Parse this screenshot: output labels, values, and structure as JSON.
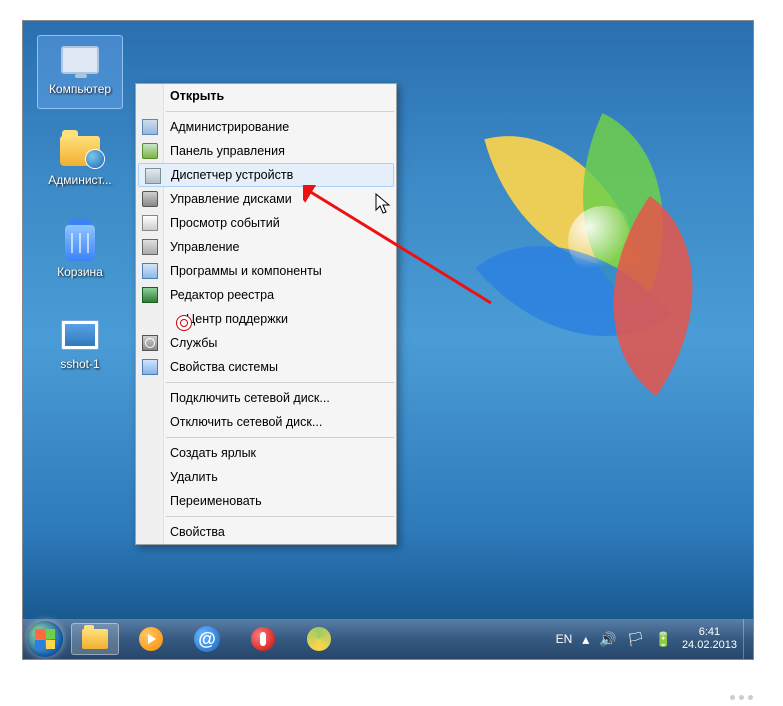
{
  "desktop_icons": [
    {
      "name": "computer-icon",
      "label": "Компьютер",
      "kind": "monitor",
      "selected": true
    },
    {
      "name": "admin-icon",
      "label": "Админист...",
      "kind": "folder-user",
      "selected": false
    },
    {
      "name": "recycle-bin-icon",
      "label": "Корзина",
      "kind": "bin",
      "selected": false
    },
    {
      "name": "sshot-icon",
      "label": "sshot-1",
      "kind": "thumb",
      "selected": false
    }
  ],
  "context_menu": {
    "header": "Открыть",
    "groups": [
      [
        {
          "icon": "ci-admin",
          "label": "Администрирование",
          "hl": false
        },
        {
          "icon": "ci-cp",
          "label": "Панель управления",
          "hl": false
        },
        {
          "icon": "ci-dev",
          "label": "Диспетчер устройств",
          "hl": true
        },
        {
          "icon": "ci-disk",
          "label": "Управление дисками",
          "hl": false
        },
        {
          "icon": "ci-event",
          "label": "Просмотр событий",
          "hl": false
        },
        {
          "icon": "ci-mgmt",
          "label": "Управление",
          "hl": false
        },
        {
          "icon": "ci-prog",
          "label": "Программы и компоненты",
          "hl": false
        },
        {
          "icon": "ci-reg",
          "label": "Редактор реестра",
          "hl": false
        },
        {
          "icon": "ci-sup",
          "label": "Центр поддержки",
          "hl": false
        },
        {
          "icon": "ci-svc",
          "label": "Службы",
          "hl": false
        },
        {
          "icon": "ci-sys",
          "label": "Свойства системы",
          "hl": false
        }
      ],
      [
        {
          "icon": "",
          "label": "Подключить сетевой диск...",
          "hl": false
        },
        {
          "icon": "",
          "label": "Отключить сетевой диск...",
          "hl": false
        }
      ],
      [
        {
          "icon": "",
          "label": "Создать ярлык",
          "hl": false
        },
        {
          "icon": "",
          "label": "Удалить",
          "hl": false
        },
        {
          "icon": "",
          "label": "Переименовать",
          "hl": false
        }
      ],
      [
        {
          "icon": "",
          "label": "Свойства",
          "hl": false
        }
      ]
    ]
  },
  "tray": {
    "lang": "EN",
    "time": "6:41",
    "date": "24.02.2013"
  }
}
